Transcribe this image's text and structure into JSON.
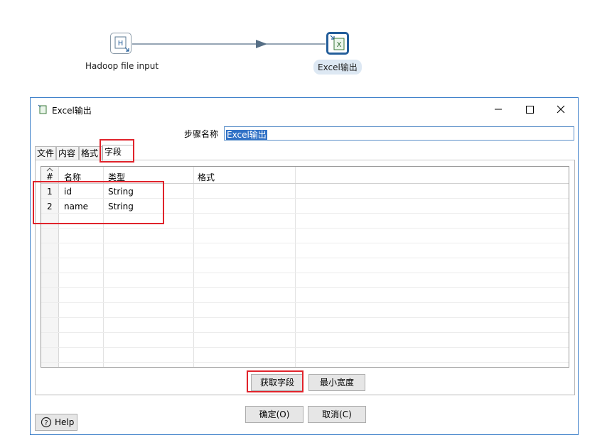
{
  "canvas": {
    "hadoop_step": {
      "label": "Hadoop file input",
      "icon": "hadoop-file-icon",
      "icon_glyph": "H"
    },
    "excel_step": {
      "label": "Excel输出",
      "icon": "excel-output-icon",
      "icon_glyph": "X"
    },
    "hop": {
      "icon": "arrow-right-icon"
    }
  },
  "dialog": {
    "title": "Excel输出",
    "title_icon": "excel-small-icon",
    "window_buttons": {
      "minimize": "—",
      "maximize": "☐",
      "close": "✕"
    },
    "step_name_label": "步骤名称",
    "step_name_value": "Excel输出",
    "tabs": [
      {
        "label": "文件",
        "active": false
      },
      {
        "label": "内容",
        "active": false
      },
      {
        "label": "格式",
        "active": false
      },
      {
        "label": "字段",
        "active": true
      }
    ],
    "table": {
      "columns": [
        "#",
        "名称",
        "类型",
        "格式"
      ],
      "rows": [
        {
          "num": "1",
          "name": "id",
          "type": "String",
          "format": ""
        },
        {
          "num": "2",
          "name": "name",
          "type": "String",
          "format": ""
        }
      ]
    },
    "buttons": {
      "get_fields": "获取字段",
      "min_width": "最小宽度",
      "ok": "确定(O)",
      "cancel": "取消(C)",
      "help": "Help"
    }
  },
  "colors": {
    "accent": "#245e9a",
    "highlight": "#e0232b",
    "selection": "#3071c6"
  }
}
